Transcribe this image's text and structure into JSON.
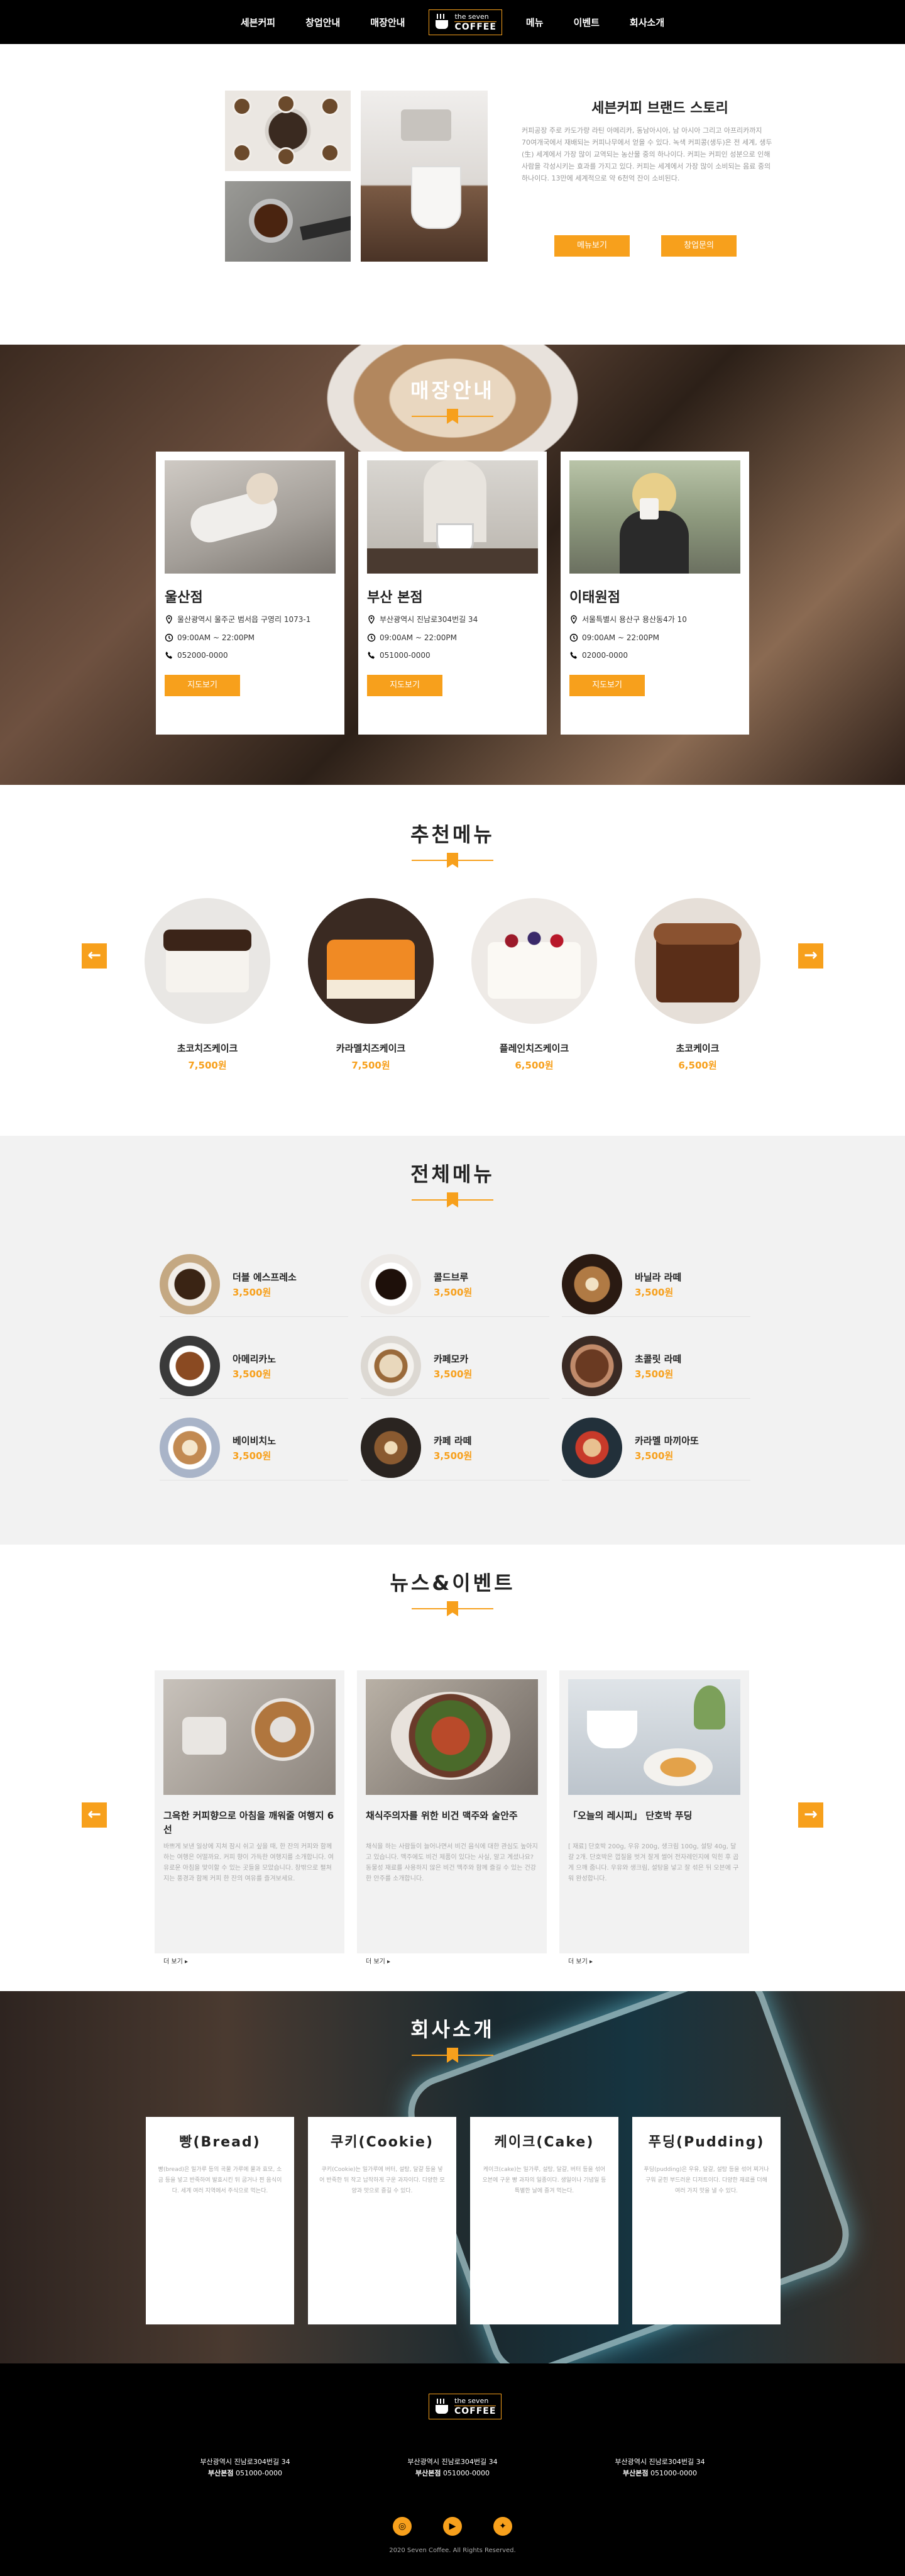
{
  "nav": {
    "items_left": [
      "세븐커피",
      "창업안내",
      "매장안내"
    ],
    "items_right": [
      "메뉴",
      "이벤트",
      "회사소개"
    ],
    "logo_top": "the seven",
    "logo_bottom": "COFFEE"
  },
  "story": {
    "title": "세븐커피 브랜드 스토리",
    "body": "커피공장 주로 카도가량 라틴 아메리카, 동남아시아, 남 아시아 그리고 아프리카까지 70여개국에서 재배되는 커피나무에서 얻을 수 있다. 녹색 커피콩(생두)은 전 세계, 생두(生) 세계에서 가장 많이 교역되는 농산물 중의 하나이다. 커피는 커피인 성분으로 인해 사람을 각성시키는 효과를 가지고 있다. 커피는 세계에서 가장 많이 소비되는 음료 중의 하나이다. 13만에 세계적으로 약 6천억 잔이 소비된다.",
    "btn_menu": "메뉴보기",
    "btn_franchise": "창업문의"
  },
  "stores": {
    "heading": "매장안내",
    "items": [
      {
        "name": "울산점",
        "address": "울산광역시 울주군 범서읍 구영리 1073-1",
        "hours": "09:00AM ~ 22:00PM",
        "phone": "052000-0000",
        "btn": "지도보기"
      },
      {
        "name": "부산 본점",
        "address": "부산광역시 진남로304번길 34",
        "hours": "09:00AM ~ 22:00PM",
        "phone": "051000-0000",
        "btn": "지도보기"
      },
      {
        "name": "이태원점",
        "address": "서울특별시 용산구 용산동4가 10",
        "hours": "09:00AM ~ 22:00PM",
        "phone": "02000-0000",
        "btn": "지도보기"
      }
    ]
  },
  "recommend": {
    "heading": "추천메뉴",
    "items": [
      {
        "name": "초코치즈케이크",
        "price": "7,500원"
      },
      {
        "name": "카라멜치즈케이크",
        "price": "7,500원"
      },
      {
        "name": "플레인치즈케이크",
        "price": "6,500원"
      },
      {
        "name": "초코케이크",
        "price": "6,500원"
      }
    ]
  },
  "allmenu": {
    "heading": "전체메뉴",
    "items": [
      {
        "name": "더블 에스프레소",
        "price": "3,500원"
      },
      {
        "name": "콜드브루",
        "price": "3,500원"
      },
      {
        "name": "바닐라 라떼",
        "price": "3,500원"
      },
      {
        "name": "아메리카노",
        "price": "3,500원"
      },
      {
        "name": "카페모카",
        "price": "3,500원"
      },
      {
        "name": "초콜릿 라떼",
        "price": "3,500원"
      },
      {
        "name": "베이비치노",
        "price": "3,500원"
      },
      {
        "name": "카페 라떼",
        "price": "3,500원"
      },
      {
        "name": "카라멜 마끼아또",
        "price": "3,500원"
      }
    ]
  },
  "news": {
    "heading": "뉴스&이벤트",
    "items": [
      {
        "title": "그윽한 커피향으로 아침을 깨워줄 여행지 6선",
        "body": "바쁘게 보낸 일상에 지쳐 잠시 쉬고 싶을 때, 한 잔의 커피와 함께하는 여행은 어떨까요. 커피 향이 가득한 여행지를 소개합니다. 여유로운 아침을 맞이할 수 있는 곳들을 모았습니다. 창밖으로 펼쳐지는 풍경과 함께 커피 한 잔의 여유를 즐겨보세요.",
        "more": "더 보기 ▸"
      },
      {
        "title": "채식주의자를 위한 비건 맥주와 술안주",
        "body": "채식을 하는 사람들이 늘어나면서 비건 음식에 대한 관심도 높아지고 있습니다. 맥주에도 비건 제품이 있다는 사실, 알고 계셨나요? 동물성 재료를 사용하지 않은 비건 맥주와 함께 즐길 수 있는 건강한 안주를 소개합니다.",
        "more": "더 보기 ▸"
      },
      {
        "title": "「오늘의 레시피」 단호박 푸딩",
        "body": "[ 재료] 단호박 200g, 우유 200g, 생크림 100g, 설탕 40g, 달걀 2개. 단호박은 껍질을 벗겨 잘게 썰어 전자레인지에 익힌 후 곱게 으깨 줍니다. 우유와 생크림, 설탕을 넣고 잘 섞은 뒤 오븐에 구워 완성합니다.",
        "more": "더 보기 ▸"
      }
    ]
  },
  "company": {
    "heading": "회사소개",
    "items": [
      {
        "title": "빵(Bread)",
        "body": "빵(bread)은 밀가루 등의 곡물 가루에 물과 효모, 소금 등을 넣고 반죽하여 발효시킨 뒤 굽거나 찐 음식이다. 세계 여러 지역에서 주식으로 먹는다."
      },
      {
        "title": "쿠키(Cookie)",
        "body": "쿠키(Cookie)는 밀가루에 버터, 설탕, 달걀 등을 넣어 반죽한 뒤 작고 납작하게 구운 과자이다. 다양한 모양과 맛으로 즐길 수 있다."
      },
      {
        "title": "케이크(Cake)",
        "body": "케이크(cake)는 밀가루, 설탕, 달걀, 버터 등을 섞어 오븐에 구운 빵 과자의 일종이다. 생일이나 기념일 등 특별한 날에 즐겨 먹는다."
      },
      {
        "title": "푸딩(Pudding)",
        "body": "푸딩(pudding)은 우유, 달걀, 설탕 등을 섞어 찌거나 구워 굳힌 부드러운 디저트이다. 다양한 재료를 더해 여러 가지 맛을 낼 수 있다."
      }
    ]
  },
  "footer": {
    "info": [
      {
        "addr": "부산광역시 진남로304번길 34",
        "label": "부산본점",
        "phone": "051000-0000"
      },
      {
        "addr": "부산광역시 진남로304번길 34",
        "label": "부산본점",
        "phone": "051000-0000"
      },
      {
        "addr": "부산광역시 진남로304번길 34",
        "label": "부산본점",
        "phone": "051000-0000"
      }
    ],
    "copyright": "2020 Seven Coffee. All Rights Reserved."
  },
  "colors": {
    "accent": "#f7a01c",
    "nav": "#000000",
    "section_gray": "#f2f2f2"
  }
}
